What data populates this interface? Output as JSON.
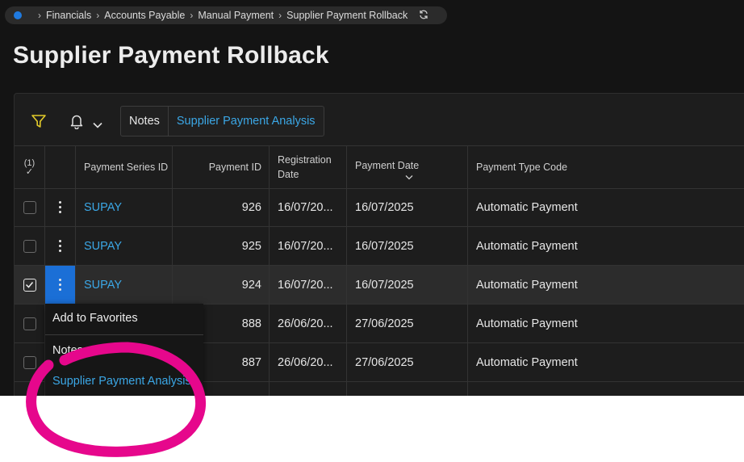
{
  "breadcrumb": {
    "items": [
      "Financials",
      "Accounts Payable",
      "Manual Payment",
      "Supplier Payment Rollback"
    ]
  },
  "page": {
    "title": "Supplier Payment Rollback"
  },
  "toolbar": {
    "notes_label": "Notes",
    "analysis_label": "Supplier Payment Analysis"
  },
  "grid": {
    "selected_count": "(1)",
    "columns": {
      "series": "Payment Series ID",
      "pid": "Payment ID",
      "reg": "Registration Date",
      "pdate": "Payment Date",
      "ptype": "Payment Type Code"
    },
    "rows": [
      {
        "series": "SUPAY",
        "pid": "926",
        "reg": "16/07/20...",
        "pdate": "16/07/2025",
        "ptype": "Automatic Payment"
      },
      {
        "series": "SUPAY",
        "pid": "925",
        "reg": "16/07/20...",
        "pdate": "16/07/2025",
        "ptype": "Automatic Payment"
      },
      {
        "series": "SUPAY",
        "pid": "924",
        "reg": "16/07/20...",
        "pdate": "16/07/2025",
        "ptype": "Automatic Payment"
      },
      {
        "series": "",
        "pid": "888",
        "reg": "26/06/20...",
        "pdate": "27/06/2025",
        "ptype": "Automatic Payment"
      },
      {
        "series": "",
        "pid": "887",
        "reg": "26/06/20...",
        "pdate": "27/06/2025",
        "ptype": "Automatic Payment"
      }
    ]
  },
  "context_menu": {
    "favorites": "Add to Favorites",
    "notes": "Notes",
    "analysis": "Supplier Payment Analysis"
  },
  "colors": {
    "accent": "#3ba7e6",
    "active": "#1b6fd6",
    "annotation": "#e6078c"
  }
}
